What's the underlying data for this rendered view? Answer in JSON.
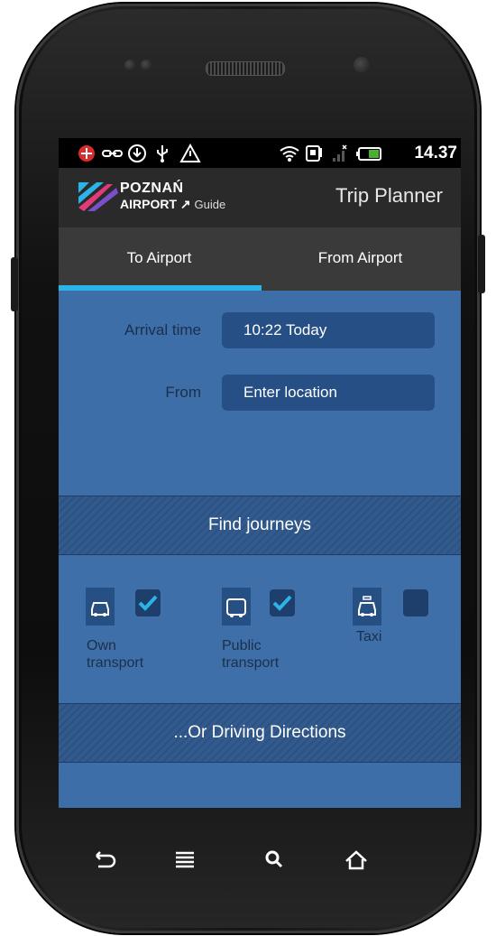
{
  "status_bar": {
    "time": "14.37",
    "icons": [
      "notification-icon",
      "link-icon",
      "download-icon",
      "usb-icon",
      "warning-icon",
      "wifi-icon",
      "sim-icon",
      "signal-icon",
      "battery-icon"
    ]
  },
  "app_bar": {
    "logo_line1": "POZNAŃ",
    "logo_line2": "AIRPORT",
    "logo_guide": "Guide",
    "title": "Trip Planner"
  },
  "tabs": [
    {
      "label": "To Airport",
      "active": true
    },
    {
      "label": "From Airport",
      "active": false
    }
  ],
  "form": {
    "arrival_label": "Arrival time",
    "arrival_value": "10:22 Today",
    "from_label": "From",
    "from_placeholder": "Enter location"
  },
  "find_button": "Find journeys",
  "options": [
    {
      "label": "Own transport",
      "checked": true,
      "icon": "car-icon"
    },
    {
      "label": "Public transport",
      "checked": true,
      "icon": "bus-icon"
    },
    {
      "label": "Taxi",
      "checked": false,
      "icon": "taxi-icon"
    }
  ],
  "driving_button": "...Or Driving Directions",
  "nav_bar": [
    "back-icon",
    "menu-icon",
    "search-icon",
    "home-icon"
  ],
  "colors": {
    "accent": "#2bb4e8",
    "screen_bg": "#3e6ea8",
    "field_bg": "#254f85",
    "check": "#2bb4e8"
  }
}
